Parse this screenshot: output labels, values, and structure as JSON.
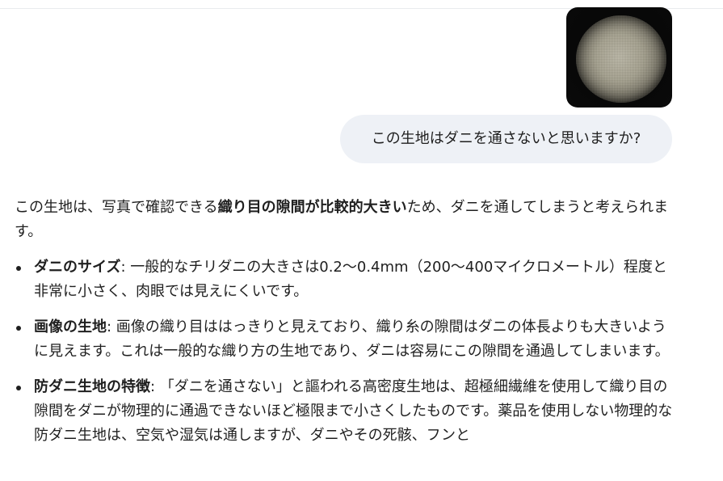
{
  "user_message": {
    "image_alt": "fabric-magnified-photo",
    "text": "この生地はダニを通さないと思いますか?"
  },
  "assistant_message": {
    "intro_part1": "この生地は、写真で確認できる",
    "intro_bold": "織り目の隙間が比較的大きい",
    "intro_part2": "ため、ダニを通してしまうと考えられます。",
    "bullets": [
      {
        "title": "ダニのサイズ",
        "text": ": 一般的なチリダニの大きさは0.2〜0.4mm（200〜400マイクロメートル）程度と非常に小さく、肉眼では見えにくいです。"
      },
      {
        "title": "画像の生地",
        "text": ": 画像の織り目ははっきりと見えており、織り糸の隙間はダニの体長よりも大きいように見えます。これは一般的な織り方の生地であり、ダニは容易にこの隙間を通過してしまいます。"
      },
      {
        "title": "防ダニ生地の特徴",
        "text": ": 「ダニを通さない」と謳われる高密度生地は、超極細繊維を使用して織り目の隙間をダニが物理的に通過できないほど極限まで小さくしたものです。薬品を使用しない物理的な防ダニ生地は、空気や湿気は通しますが、ダニやその死骸、フンと"
      }
    ]
  }
}
